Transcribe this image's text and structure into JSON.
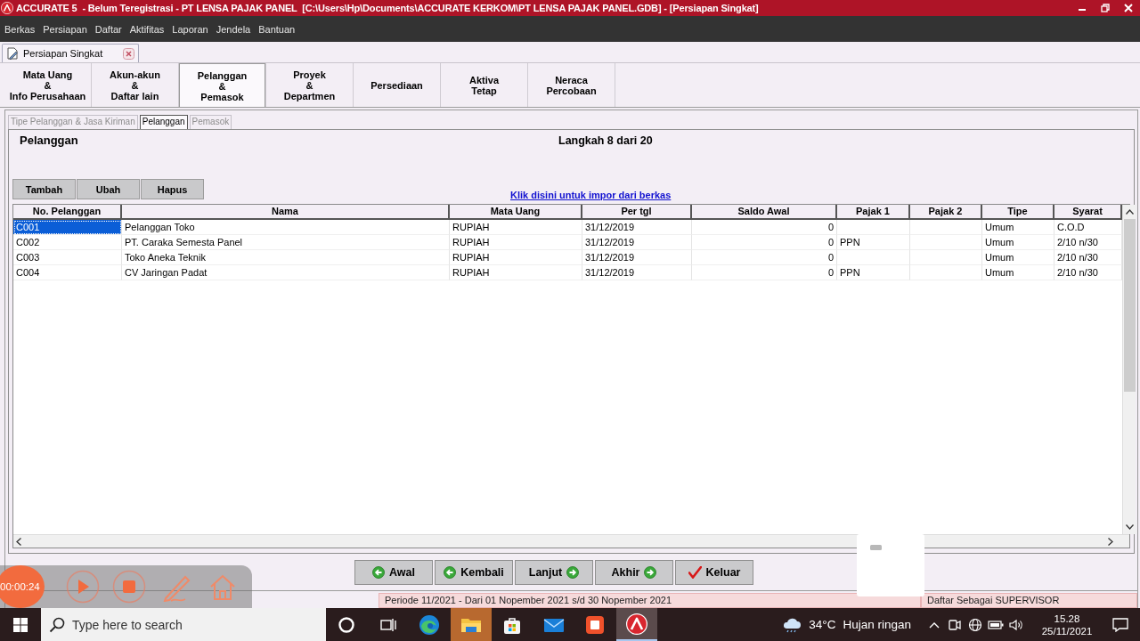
{
  "title_bar": {
    "title": "ACCURATE 5  - Belum Teregistrasi - PT LENSA PAJAK PANEL  [C:\\Users\\Hp\\Documents\\ACCURATE KERKOM\\PT LENSA PAJAK PANEL.GDB] - [Persiapan Singkat]"
  },
  "menu": [
    "Berkas",
    "Persiapan",
    "Daftar",
    "Aktifitas",
    "Laporan",
    "Jendela",
    "Bantuan"
  ],
  "document_tab": {
    "label": "Persiapan Singkat"
  },
  "step_tabs": [
    {
      "label": "Mata Uang\n&\nInfo Perusahaan",
      "selected": false
    },
    {
      "label": "Akun-akun\n&\nDaftar lain",
      "selected": false
    },
    {
      "label": "Pelanggan\n&\nPemasok",
      "selected": true
    },
    {
      "label": "Proyek\n&\nDepartmen",
      "selected": false
    },
    {
      "label": "Persediaan",
      "selected": false
    },
    {
      "label": "Aktiva\nTetap",
      "selected": false
    },
    {
      "label": "Neraca\nPercobaan",
      "selected": false
    }
  ],
  "sub_tabs": [
    {
      "label": "Tipe Pelanggan & Jasa Kiriman",
      "selected": false
    },
    {
      "label": "Pelanggan",
      "selected": true
    },
    {
      "label": "Pemasok",
      "selected": false
    }
  ],
  "section": {
    "title": "Pelanggan",
    "step": "Langkah 8 dari 20"
  },
  "actions": [
    "Tambah",
    "Ubah",
    "Hapus"
  ],
  "import_link": "Klik disini untuk impor dari berkas",
  "table": {
    "columns": [
      {
        "label": "No. Pelanggan",
        "kind": "text"
      },
      {
        "label": "Nama",
        "kind": "text"
      },
      {
        "label": "Mata Uang",
        "kind": "text"
      },
      {
        "label": "Per tgl",
        "kind": "text"
      },
      {
        "label": "Saldo Awal",
        "kind": "number"
      },
      {
        "label": "Pajak 1",
        "kind": "text"
      },
      {
        "label": "Pajak 2",
        "kind": "text"
      },
      {
        "label": "Tipe",
        "kind": "text"
      },
      {
        "label": "Syarat",
        "kind": "text"
      }
    ],
    "rows": [
      {
        "cells": [
          "C001",
          "Pelanggan Toko",
          "RUPIAH",
          "31/12/2019",
          "0",
          null,
          null,
          "Umum",
          "C.O.D"
        ],
        "selected": true
      },
      {
        "cells": [
          "C002",
          "PT. Caraka Semesta Panel",
          "RUPIAH",
          "31/12/2019",
          "0",
          "PPN",
          null,
          "Umum",
          "2/10 n/30"
        ],
        "selected": false
      },
      {
        "cells": [
          "C003",
          "Toko Aneka Teknik",
          "RUPIAH",
          "31/12/2019",
          "0",
          null,
          null,
          "Umum",
          "2/10 n/30"
        ],
        "selected": false
      },
      {
        "cells": [
          "C004",
          "CV Jaringan Padat",
          "RUPIAH",
          "31/12/2019",
          "0",
          "PPN",
          null,
          "Umum",
          "2/10 n/30"
        ],
        "selected": false
      }
    ]
  },
  "nav_buttons": [
    {
      "label": "Awal",
      "kind": "back"
    },
    {
      "label": "Kembali",
      "kind": "back"
    },
    {
      "label": "Lanjut",
      "kind": "next"
    },
    {
      "label": "Akhir",
      "kind": "next"
    },
    {
      "label": "Keluar",
      "kind": "exit"
    }
  ],
  "status_bar": {
    "period": "Periode 11/2021 - Dari 01 Nopember 2021 s/d 30 Nopember 2021",
    "user": "Daftar Sebagai SUPERVISOR"
  },
  "recorder": {
    "time": "00:00:24"
  },
  "taskbar": {
    "search": {
      "placeholder": "Type here to search"
    },
    "apps": [
      {
        "kind": "cortana",
        "selected": false,
        "hovered": false
      },
      {
        "kind": "taskview",
        "selected": false,
        "hovered": false
      },
      {
        "kind": "edge",
        "selected": false,
        "hovered": false
      },
      {
        "kind": "explorer",
        "selected": false,
        "hovered": true
      },
      {
        "kind": "store",
        "selected": false,
        "hovered": false
      },
      {
        "kind": "mail",
        "selected": false,
        "hovered": false
      },
      {
        "kind": "recorder",
        "selected": false,
        "hovered": false
      },
      {
        "kind": "accurate",
        "selected": true,
        "hovered": false
      }
    ],
    "temperature": "34°C",
    "weather": "Hujan ringan",
    "time": "15.28",
    "date": "25/11/2021"
  }
}
